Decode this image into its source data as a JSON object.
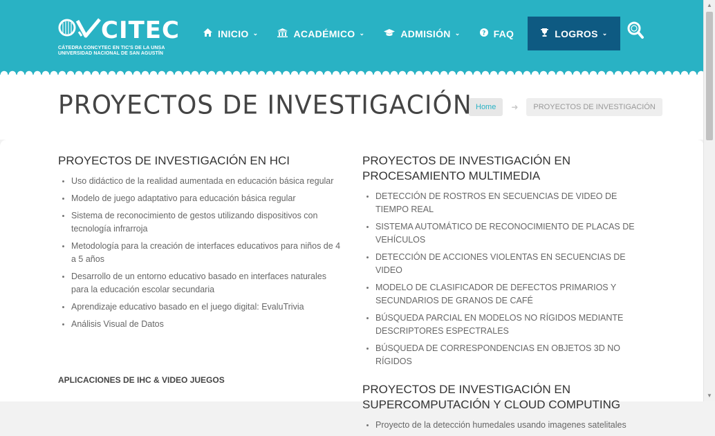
{
  "logo": {
    "name": "CITEC",
    "sub1": "CÁTEDRA CONCYTEC EN TIC'S DE LA UNSA",
    "sub2": "UNIVERSIDAD NACIONAL DE SAN AGUSTÍN"
  },
  "nav": {
    "items": [
      {
        "label": "INICIO",
        "icon": "home-icon",
        "caret": "⌄"
      },
      {
        "label": "ACADÉMICO",
        "icon": "bank-icon",
        "caret": "⌄"
      },
      {
        "label": "ADMISIÓN",
        "icon": "graduation-cap-icon",
        "caret": "⌄"
      },
      {
        "label": "FAQ",
        "icon": "question-circle-icon"
      },
      {
        "label": "LOGROS",
        "icon": "trophy-icon",
        "caret": "⌄"
      }
    ]
  },
  "page": {
    "title": "PROYECTOS DE INVESTIGACIÓN"
  },
  "breadcrumb": {
    "home": "Home",
    "current": "PROYECTOS DE INVESTIGACIÓN"
  },
  "left": {
    "section_title": "PROYECTOS DE INVESTIGACIÓN EN HCI",
    "items": [
      "Uso didáctico de la realidad aumentada en educación básica regular",
      "Modelo de juego adaptativo para educación básica regular",
      "Sistema de reconocimiento de gestos utilizando dispositivos con tecnología infrarroja",
      "Metodología para la creación de interfaces educativos para niños de 4 a 5 años",
      "Desarrollo de un entorno educativo basado en interfaces naturales para la educación escolar secundaria",
      "Aprendizaje educativo basado en el juego digital: EvaluTrivia",
      "Análisis Visual de Datos"
    ],
    "subheading": "APLICACIONES DE IHC & VIDEO JUEGOS"
  },
  "right": {
    "section1_title": "PROYECTOS DE INVESTIGACIÓN EN PROCESAMIENTO MULTIMEDIA",
    "section1_items": [
      "DETECCIÓN DE ROSTROS EN SECUENCIAS DE VIDEO DE TIEMPO REAL",
      "SISTEMA AUTOMÁTICO DE RECONOCIMIENTO DE PLACAS DE VEHÍCULOS",
      "DETECCIÓN DE ACCIONES VIOLENTAS EN SECUENCIAS DE VIDEO",
      "MODELO DE CLASIFICADOR DE DEFECTOS PRIMARIOS Y SECUNDARIOS DE GRANOS DE CAFÉ",
      "BÚSQUEDA PARCIAL EN MODELOS NO RÍGIDOS MEDIANTE DESCRIPTORES ESPECTRALES",
      "BÚSQUEDA DE CORRESPONDENCIAS EN OBJETOS 3D NO RÍGIDOS"
    ],
    "section2_title": "PROYECTOS DE INVESTIGACIÓN EN SUPERCOMPUTACIÓN Y CLOUD COMPUTING",
    "section2_items": [
      "Proyecto de la detección humedales usando imagenes satelitales"
    ]
  },
  "colors": {
    "header": "#29b2c4",
    "active_nav": "#0e5a82"
  }
}
